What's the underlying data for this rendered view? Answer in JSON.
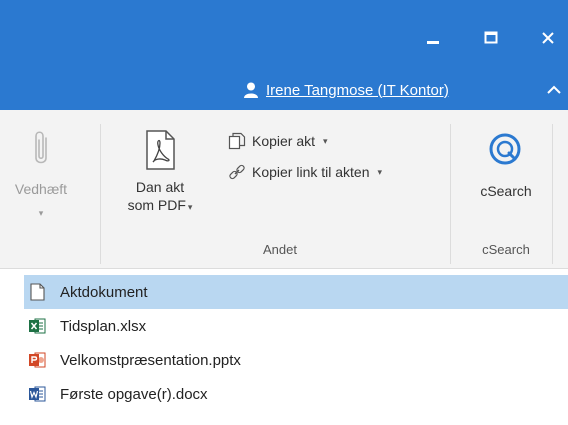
{
  "window": {
    "minimize_icon": "minimize-icon",
    "maximize_icon": "maximize-icon",
    "close_icon": "close-icon"
  },
  "user": {
    "name": "Irene Tangmose (IT Kontor)"
  },
  "ribbon": {
    "attach": {
      "label": "Vedhæft",
      "dropdown": "▾",
      "enabled": false
    },
    "dan_akt": {
      "label_line1": "Dan akt",
      "label_line2": "som PDF",
      "dropdown": "▾"
    },
    "kopier_akt": {
      "label": "Kopier akt",
      "dropdown": "▾"
    },
    "kopier_link": {
      "label": "Kopier link til akten",
      "dropdown": "▾"
    },
    "csearch": {
      "label": "cSearch"
    },
    "groups": {
      "andet": "Andet",
      "csearch": "cSearch"
    }
  },
  "files": [
    {
      "name": "Aktdokument",
      "type": "document",
      "selected": true
    },
    {
      "name": "Tidsplan.xlsx",
      "type": "excel",
      "selected": false
    },
    {
      "name": "Velkomstpræsentation.pptx",
      "type": "powerpoint",
      "selected": false
    },
    {
      "name": "Første opgave(r).docx",
      "type": "word",
      "selected": false
    }
  ],
  "colors": {
    "titlebar": "#2b79d0",
    "ribbon": "#f3f3f3",
    "selection": "#b9d7f1",
    "excel": "#1e7145",
    "powerpoint": "#d24726",
    "word": "#2b579a"
  }
}
